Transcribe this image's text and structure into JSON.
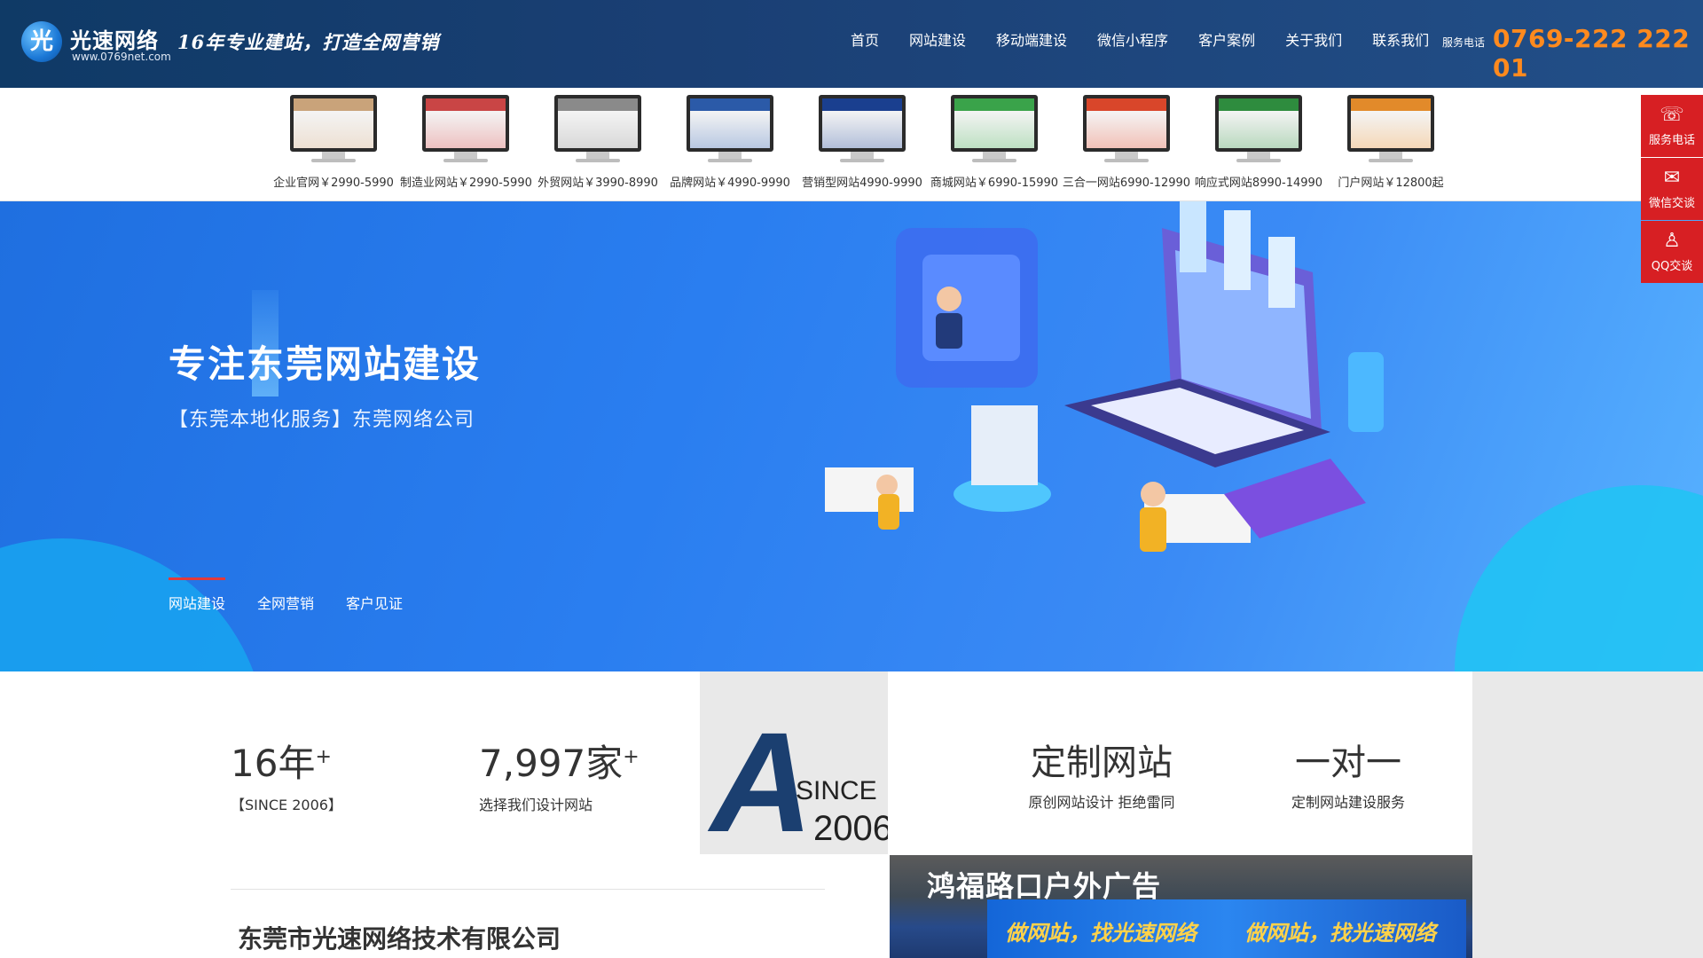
{
  "header": {
    "logo_char": "光",
    "brand": "光速网络",
    "url": "www.0769net.com",
    "slogan": "16年专业建站，打造全网营销",
    "nav": [
      "首页",
      "网站建设",
      "移动端建设",
      "微信小程序",
      "客户案例",
      "关于我们",
      "联系我们"
    ],
    "phone_label": "服务电话",
    "phone": "0769-222 222 01"
  },
  "products": [
    {
      "label": "企业官网￥2990-5990",
      "color": "#c9a37a"
    },
    {
      "label": "制造业网站￥2990-5990",
      "color": "#c94545"
    },
    {
      "label": "外贸网站￥3990-8990",
      "color": "#8a8a8a"
    },
    {
      "label": "品牌网站￥4990-9990",
      "color": "#2b5aa8"
    },
    {
      "label": "营销型网站4990-9990",
      "color": "#1a3f8f"
    },
    {
      "label": "商城网站￥6990-15990",
      "color": "#3aa34a"
    },
    {
      "label": "三合一网站6990-12990",
      "color": "#d9462a"
    },
    {
      "label": "响应式网站8990-14990",
      "color": "#2e8c3e"
    },
    {
      "label": "门户网站￥12800起",
      "color": "#e28a2a"
    }
  ],
  "hero": {
    "title": "专注东莞网站建设",
    "subtitle": "【东莞本地化服务】东莞网络公司",
    "tabs": [
      "网站建设",
      "全网营销",
      "客户见证"
    ]
  },
  "side": [
    {
      "icon": "phone-icon",
      "glyph": "☏",
      "label": "服务电话"
    },
    {
      "icon": "wechat-icon",
      "glyph": "✉",
      "label": "微信交谈"
    },
    {
      "icon": "qq-icon",
      "glyph": "♙",
      "label": "QQ交谈"
    }
  ],
  "stats": {
    "years": "16年",
    "years_since": "【SINCE 2006】",
    "clients": "7,997家",
    "clients_desc": "选择我们设计网站",
    "plus": "+",
    "since_letter": "A",
    "since_word": "SINCE",
    "since_year": "2006",
    "custom_title": "定制网站",
    "custom_desc": "原创网站设计 拒绝雷同",
    "one_title": "一对一",
    "one_desc": "定制网站建设服务",
    "company": "东莞市光速网络技术有限公司",
    "ad_title": "鸿福路口户外广告",
    "ad_screen_1": "做网站，找光速网络",
    "ad_screen_2": "做网站，找光速网络"
  },
  "colors": {
    "header_bg": "#1a3f74",
    "phone": "#ff8a1e",
    "side_red": "#d71f23",
    "hero_blue": "#2a7ef0"
  }
}
